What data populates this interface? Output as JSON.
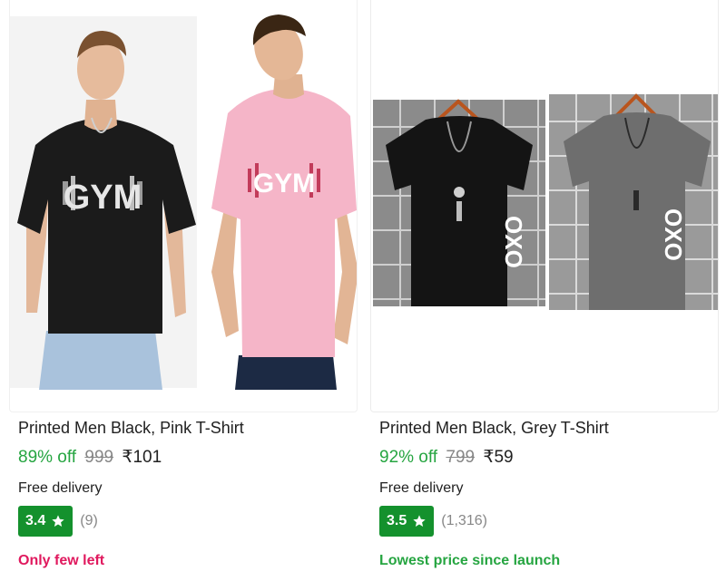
{
  "products": [
    {
      "title": "Printed Men Black, Pink T-Shirt",
      "discount": "89% off",
      "mrp": "999",
      "price": "₹101",
      "delivery": "Free delivery",
      "rating": "3.4",
      "rating_count": "(9)",
      "tag": "Only few left",
      "image_text_1": "GYM",
      "image_text_2": "GYM"
    },
    {
      "title": "Printed Men Black, Grey T-Shirt",
      "discount": "92% off",
      "mrp": "799",
      "price": "₹59",
      "delivery": "Free delivery",
      "rating": "3.5",
      "rating_count": "(1,316)",
      "tag": "Lowest price since launch",
      "image_text_1": "OXO",
      "image_text_2": "OXO"
    }
  ],
  "colors": {
    "discount_green": "#26a541",
    "rating_badge": "#14912d",
    "few_left_pink": "#e0195e",
    "muted_gray": "#878787"
  },
  "icons": [
    "star-icon"
  ]
}
